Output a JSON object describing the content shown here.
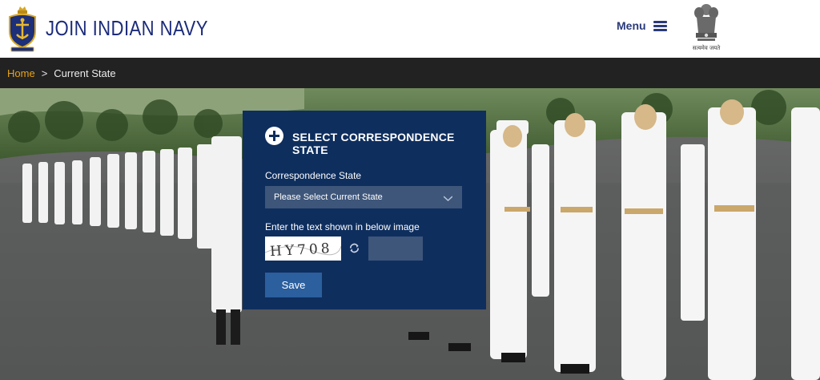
{
  "header": {
    "site_title": "JOIN INDIAN NAVY",
    "menu_label": "Menu",
    "emblem_motto": "सत्यमेव जयते"
  },
  "breadcrumb": {
    "home": "Home",
    "separator": ">",
    "current": "Current State"
  },
  "form": {
    "title": "SELECT CORRESPONDENCE STATE",
    "state_label": "Correspondence State",
    "state_selected": "Please Select Current State",
    "captcha_label": "Enter the text shown in below image",
    "captcha_text": "HY708",
    "captcha_value": "",
    "save_label": "Save"
  },
  "colors": {
    "brand_navy": "#1b2b7a",
    "breadcrumb_bg": "#222222",
    "breadcrumb_link": "#e8a317",
    "panel_bg": "#0e2e5e",
    "field_bg": "#3e567a",
    "button_bg": "#2b5f9e"
  },
  "icons": [
    "navy-crest-logo",
    "hamburger-icon",
    "national-emblem",
    "plus-circle-icon",
    "chevron-down-icon",
    "refresh-icon"
  ]
}
